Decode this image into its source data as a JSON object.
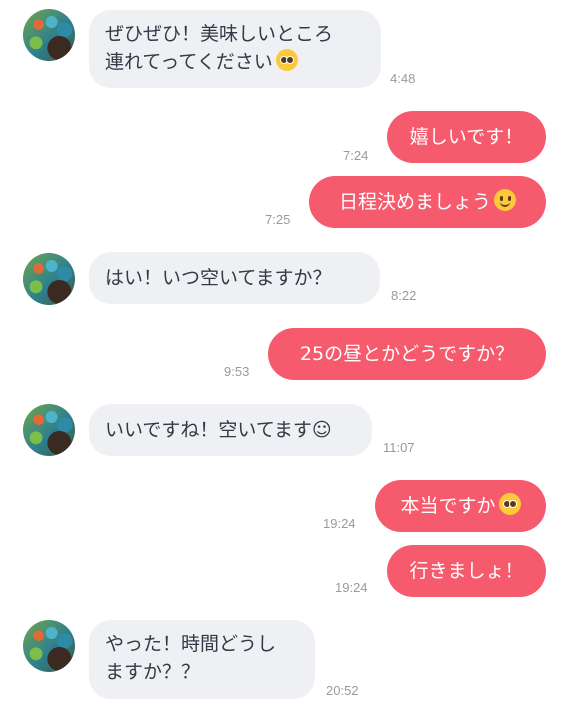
{
  "messages": [
    {
      "text": "ぜひぜひ！美味しいところ",
      "text2": "連れてってください",
      "time": "4:48"
    },
    {
      "text": "嬉しいです！",
      "time": "7:24"
    },
    {
      "text": "日程決めましょう",
      "time": "7:25"
    },
    {
      "text": "はい！いつ空いてますか？",
      "time": "8:22"
    },
    {
      "text": "25の昼とかどうですか？",
      "time": "9:53"
    },
    {
      "text": "いいですね！空いてます☺︎",
      "time": "11:07"
    },
    {
      "text": "本当ですか",
      "time": "19:24"
    },
    {
      "text": "行きましょ！",
      "time": "19:24"
    },
    {
      "text": "やった！時間どうし",
      "text2": "ますか？？",
      "time": "20:52"
    }
  ]
}
